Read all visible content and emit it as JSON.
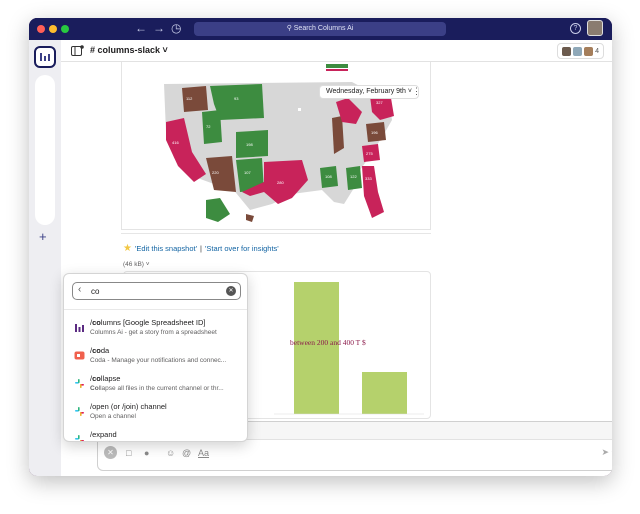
{
  "titlebar": {
    "search_placeholder": "Search Columns Ai",
    "help_label": "?"
  },
  "header": {
    "channel_name": "# columns-slack",
    "member_count": "4"
  },
  "map": {
    "date_label": "Wednesday, February 9th",
    "state_values": [
      "112",
      "93",
      "72",
      "198",
      "107",
      "416",
      "220",
      "280",
      "122",
      "108",
      "327",
      "196",
      "275",
      "333"
    ]
  },
  "message": {
    "link_edit": "'Edit this snapshot'",
    "link_sep": "|",
    "link_start": "'Start over for insights'",
    "file_size": "(46 kB)"
  },
  "bar_chart": {
    "overlay_text": "between 200 and 400 T $"
  },
  "popup": {
    "query": "co",
    "commands": [
      {
        "prefix": "/",
        "match": "co",
        "rest": "lumns [Google Spreadsheet ID]",
        "desc_match": "",
        "desc": "Columns Ai - get a story from a spreadsheet",
        "icon_color": "#5b2b82"
      },
      {
        "prefix": "/",
        "match": "co",
        "rest": "da",
        "desc_match": "",
        "desc": "Coda - Manage your notifications and connec...",
        "icon_color": "#f0604d"
      },
      {
        "prefix": "/",
        "match": "co",
        "rest": "llapse",
        "desc_match": "Co",
        "desc": "llapse all files in the current channel or thr...",
        "icon_color": "#36c5f0"
      },
      {
        "prefix": "/open (or /join) channel",
        "match": "",
        "rest": "",
        "desc_match": "",
        "desc": "Open a channel",
        "icon_color": "#36c5f0"
      },
      {
        "prefix": "/expand",
        "match": "",
        "rest": "",
        "desc_match": "",
        "desc": "",
        "icon_color": "#36c5f0"
      }
    ]
  },
  "colors": {
    "titlebar": "#1a1d5c",
    "accent_link": "#1264a3",
    "map_green": "#3d8c40",
    "map_brown": "#7a4a3a",
    "map_crimson": "#c8235a",
    "bar_green": "#b5d16c"
  }
}
